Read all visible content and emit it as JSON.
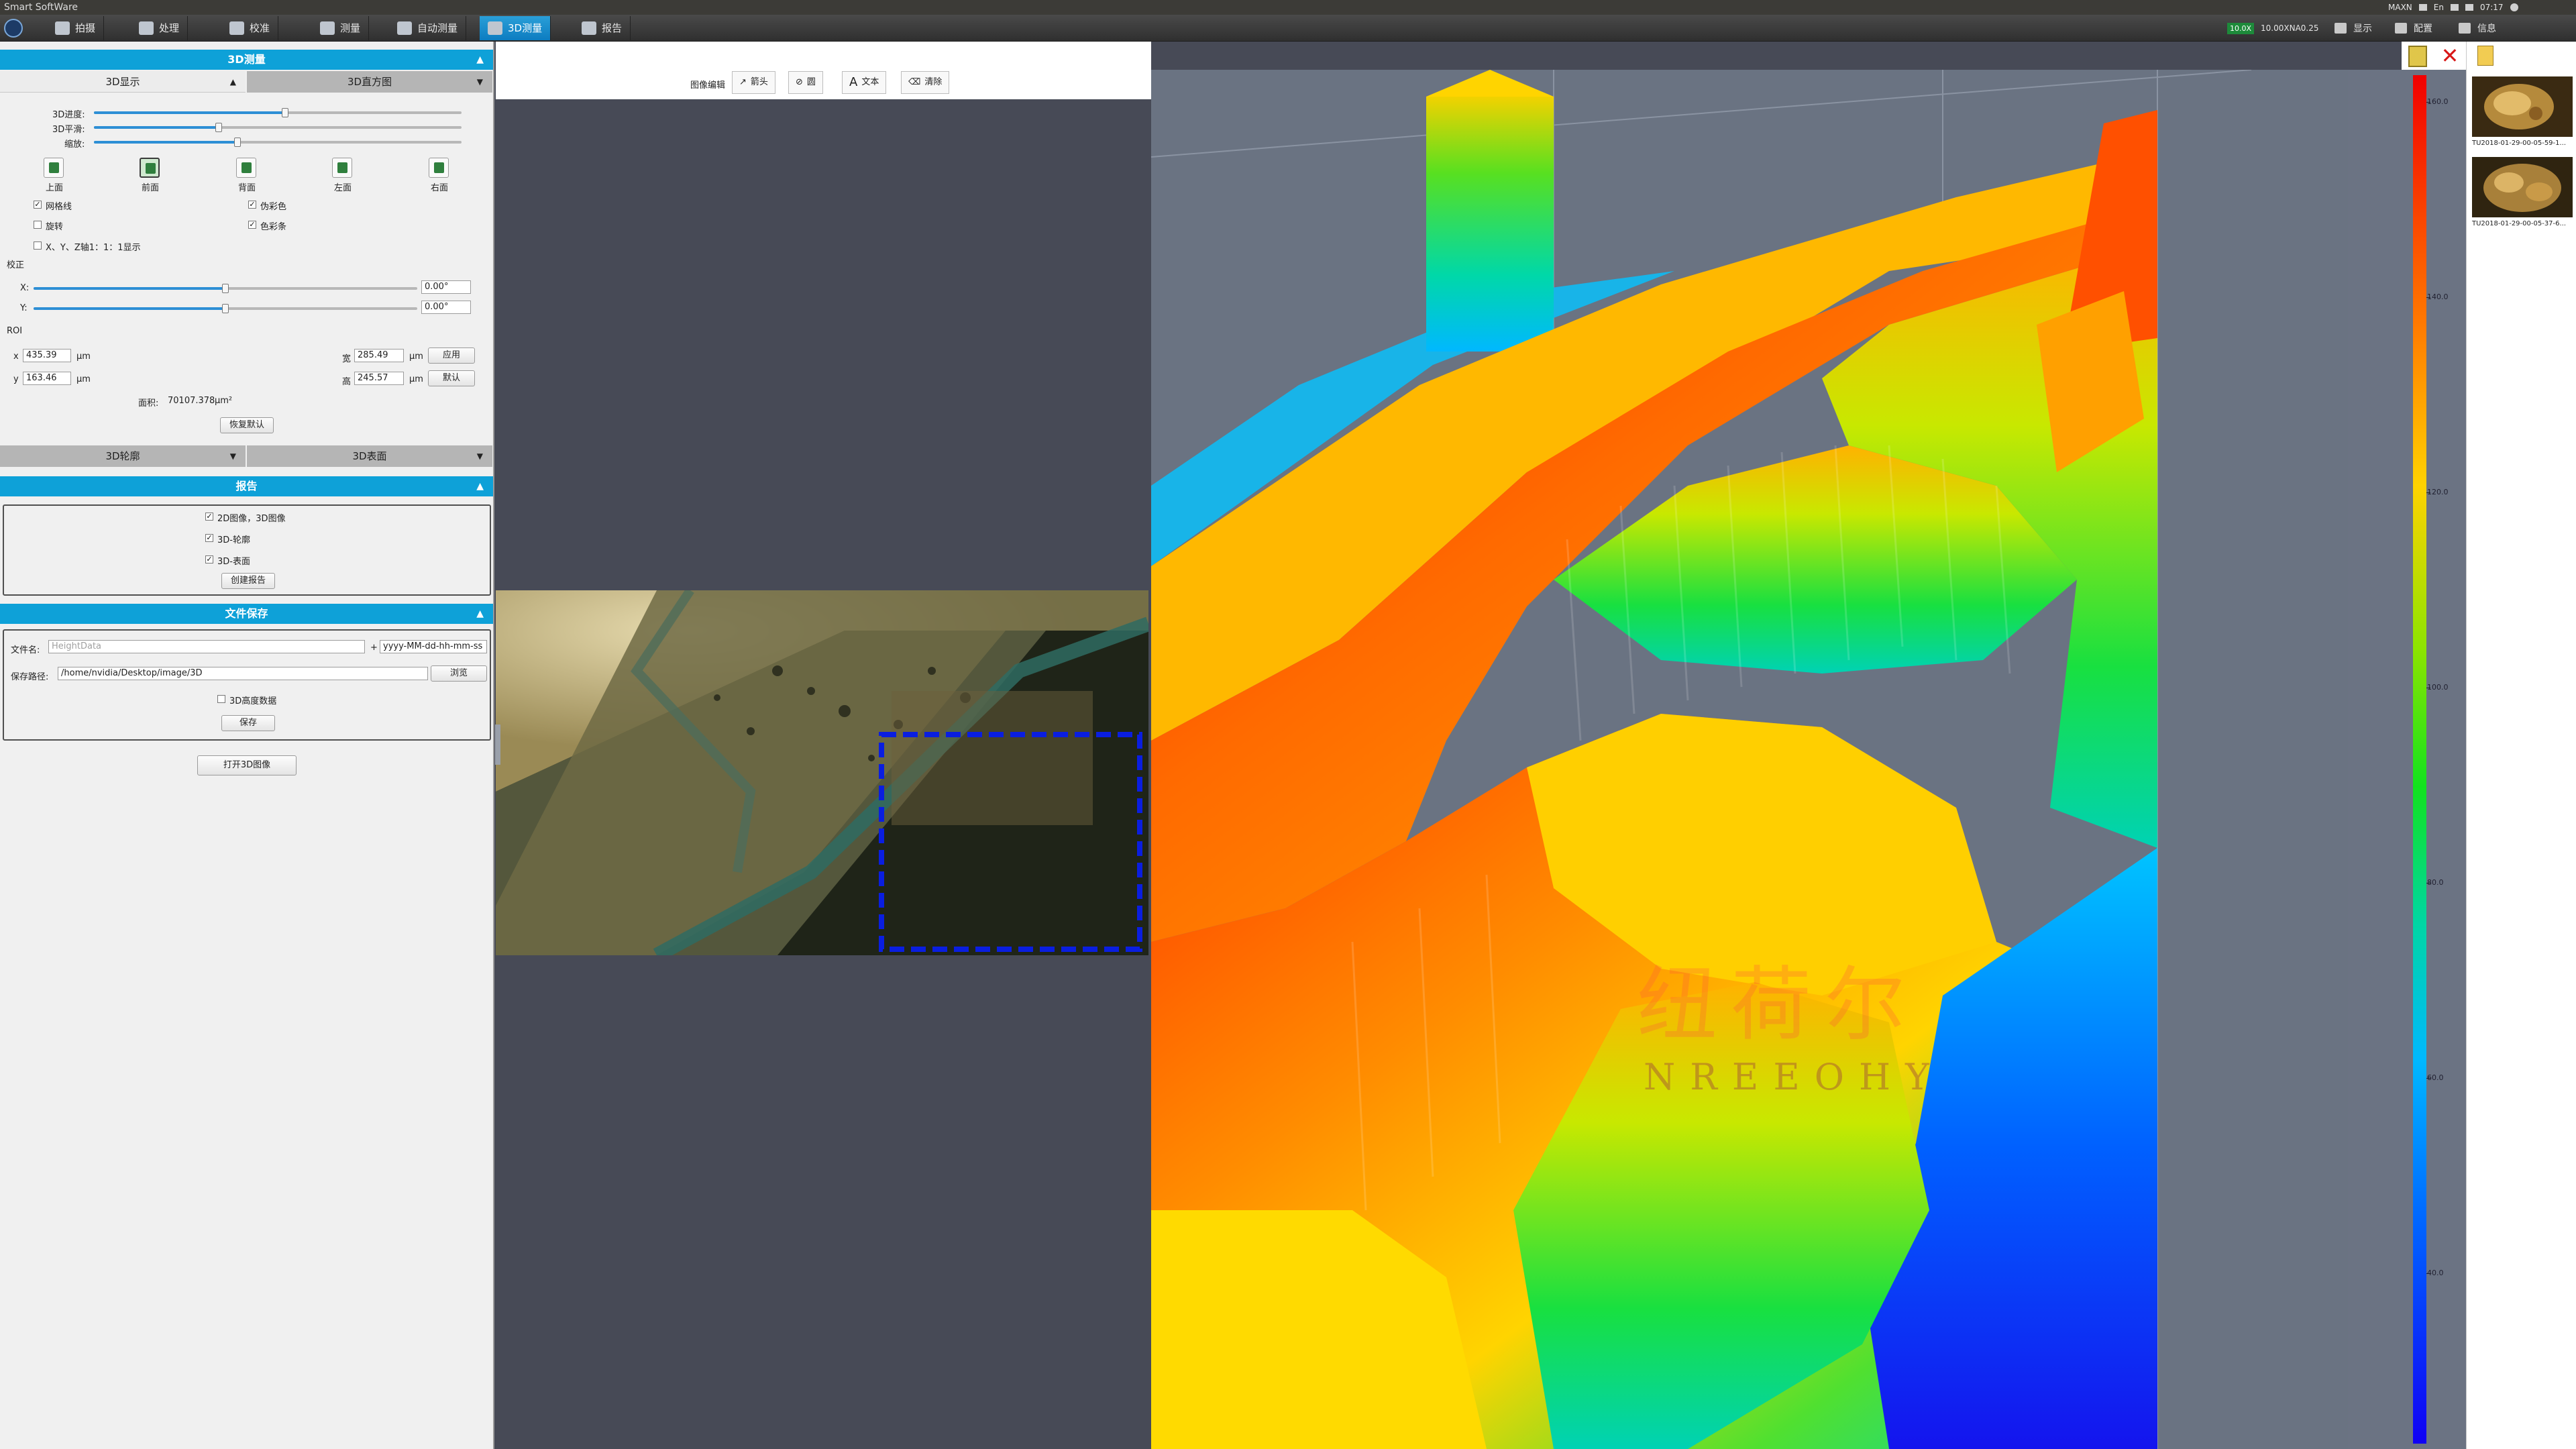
{
  "window": {
    "title": "Smart SoftWare"
  },
  "toolbar": {
    "tabs": [
      {
        "label": "拍摄",
        "active": false
      },
      {
        "label": "处理",
        "active": false
      },
      {
        "label": "校准",
        "active": false
      },
      {
        "label": "测量",
        "active": false
      },
      {
        "label": "自动测量",
        "active": false
      },
      {
        "label": "3D测量",
        "active": true
      },
      {
        "label": "报告",
        "active": false
      }
    ],
    "status_text": "10.00XNA0.25",
    "display_label": "显示",
    "config_label": "配置",
    "info_label": "信息"
  },
  "system_tray": {
    "power_mode": "MAXN",
    "time": "07:17",
    "input_method": "En"
  },
  "panel_3d": {
    "header": "3D测量",
    "tabs": {
      "display": "3D显示",
      "histogram": "3D直方图"
    },
    "sliders": {
      "accuracy_label": "3D进度:",
      "accuracy_value": 0.52,
      "smooth_label": "3D平滑:",
      "smooth_value": 0.34,
      "zoom_label": "缩放:",
      "zoom_value": 0.39
    },
    "views": [
      {
        "label": "上面",
        "selected": false
      },
      {
        "label": "前面",
        "selected": true
      },
      {
        "label": "背面",
        "selected": false
      },
      {
        "label": "左面",
        "selected": false
      },
      {
        "label": "右面",
        "selected": false
      }
    ],
    "options": {
      "grid": {
        "label": "网格线",
        "checked": true
      },
      "pseudo_color": {
        "label": "伪彩色",
        "checked": true
      },
      "rotate": {
        "label": "旋转",
        "checked": false
      },
      "color_bar": {
        "label": "色彩条",
        "checked": true
      },
      "axis_ratio": {
        "label": "X、Y、Z轴1：1：1显示",
        "checked": false
      }
    },
    "correction": {
      "label": "校正",
      "x_label": "X:",
      "x_value": "0.00°",
      "x_level": 0.5,
      "y_label": "Y:",
      "y_value": "0.00°",
      "y_level": 0.5
    },
    "roi": {
      "label": "ROI",
      "x_label": "x",
      "x_value": "435.39",
      "x_unit": "μm",
      "y_label": "y",
      "y_value": "163.46",
      "y_unit": "μm",
      "width_label": "宽",
      "width_value": "285.49",
      "width_unit": "μm",
      "height_label": "高",
      "height_value": "245.57",
      "height_unit": "μm",
      "apply_button": "应用",
      "default_button": "默认",
      "area_label": "面积:",
      "area_value": "70107.378",
      "area_unit": "μm²",
      "restore_button": "恢复默认"
    },
    "profile_tab": "3D轮廓",
    "surface_tab": "3D表面"
  },
  "panel_report": {
    "header": "报告",
    "items": [
      {
        "label": "2D图像，3D图像",
        "checked": true
      },
      {
        "label": "3D-轮廓",
        "checked": true
      },
      {
        "label": "3D-表面",
        "checked": true
      }
    ],
    "create_button": "创建报告"
  },
  "panel_save": {
    "header": "文件保存",
    "filename_label": "文件名:",
    "filename_placeholder": "HeightData",
    "plus": "+",
    "date_format": "yyyy-MM-dd-hh-mm-ss",
    "path_label": "保存路径:",
    "path_value": "/home/nvidia/Desktop/image/3D",
    "browse_button": "浏览",
    "height_data_option": {
      "label": "3D高度数据",
      "checked": false
    },
    "save_button": "保存",
    "open_button": "打开3D图像"
  },
  "image_edit": {
    "label": "图像编辑",
    "tools": [
      {
        "label": "箭头",
        "icon": "arrow-icon"
      },
      {
        "label": "圆",
        "icon": "circle-icon"
      },
      {
        "label": "文本",
        "icon": "text-icon"
      },
      {
        "label": "清除",
        "icon": "eraser-icon"
      }
    ]
  },
  "colorbar": {
    "ticks": [
      "160.0",
      "140.0",
      "120.0",
      "100.0",
      "80.0",
      "60.0",
      "40.0"
    ],
    "top_color": "#f20000",
    "bottom_color": "#1000f4"
  },
  "watermark": {
    "cn": "纽荷尔",
    "en": "NREEOHY"
  },
  "gallery": {
    "thumbnails": [
      {
        "caption": "TU2018-01-29-00-05-59-1..."
      },
      {
        "caption": "TU2018-01-29-00-05-37-6..."
      }
    ]
  },
  "colors": {
    "accent": "#0ea1d8",
    "active_tab": "#1a8fd0",
    "roi_box": "#0a1ee0"
  }
}
